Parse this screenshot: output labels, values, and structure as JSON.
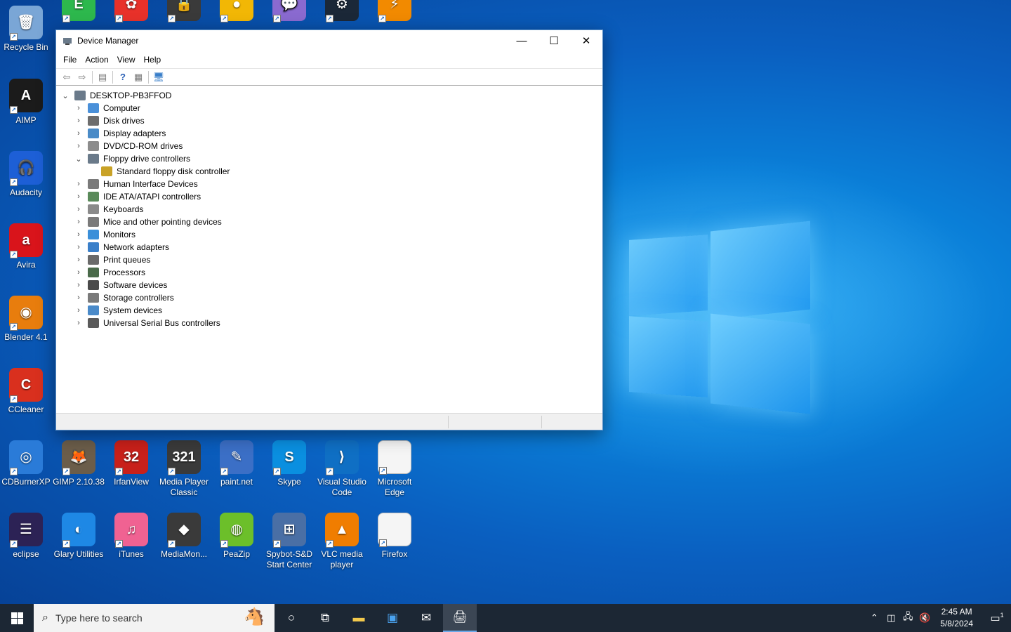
{
  "desktop": {
    "icons_col1": [
      {
        "label": "Recycle Bin",
        "color": "#7aa6d6",
        "glyph": "🗑"
      },
      {
        "label": "AIMP",
        "color": "#1b1b1b",
        "glyph": "A"
      },
      {
        "label": "Audacity",
        "color": "#1d5fd6",
        "glyph": "🎧"
      },
      {
        "label": "Avira",
        "color": "#d9141b",
        "glyph": "a"
      },
      {
        "label": "Blender 4.1",
        "color": "#e87d0d",
        "glyph": "◉"
      },
      {
        "label": "CCleaner",
        "color": "#d9301e",
        "glyph": "C"
      }
    ],
    "icons_top": [
      {
        "color": "#2db84d",
        "glyph": "E"
      },
      {
        "color": "#e8312a",
        "glyph": "✿"
      },
      {
        "color": "#3a3a3a",
        "glyph": "🔒"
      },
      {
        "color": "#f2b705",
        "glyph": "●"
      },
      {
        "color": "#8a6ad0",
        "glyph": "💬"
      },
      {
        "color": "#1b2838",
        "glyph": "⚙"
      },
      {
        "color": "#f28a00",
        "glyph": "⚡"
      }
    ],
    "icons_row1": [
      {
        "label": "CDBurnerXP",
        "color": "#2a7bd8",
        "glyph": "◎"
      },
      {
        "label": "GIMP 2.10.38",
        "color": "#6b5d4a",
        "glyph": "🦊"
      },
      {
        "label": "IrfanView",
        "color": "#c8201a",
        "glyph": "32"
      },
      {
        "label": "Media Player Classic",
        "color": "#3a3a3a",
        "glyph": "321"
      },
      {
        "label": "paint.net",
        "color": "#3b6fc6",
        "glyph": "✎"
      },
      {
        "label": "Skype",
        "color": "#0a8fe0",
        "glyph": "S"
      },
      {
        "label": "Visual Studio Code",
        "color": "#0f6fc4",
        "glyph": "⟩"
      },
      {
        "label": "Microsoft Edge",
        "color": "#f5f5f5",
        "glyph": ""
      }
    ],
    "icons_row2": [
      {
        "label": "eclipse",
        "color": "#2c2255",
        "glyph": "☰"
      },
      {
        "label": "Glary Utilities",
        "color": "#1e88e5",
        "glyph": "◐"
      },
      {
        "label": "iTunes",
        "color": "#f06292",
        "glyph": "♫"
      },
      {
        "label": "MediaMon...",
        "color": "#3a3a3a",
        "glyph": "◆"
      },
      {
        "label": "PeaZip",
        "color": "#6cbf2a",
        "glyph": "◍"
      },
      {
        "label": "Spybot-S&D Start Center",
        "color": "#4a6fa5",
        "glyph": "⊞"
      },
      {
        "label": "VLC media player",
        "color": "#f07d00",
        "glyph": "▲"
      },
      {
        "label": "Firefox",
        "color": "#f5f5f5",
        "glyph": ""
      }
    ]
  },
  "window": {
    "title": "Device Manager",
    "minimize": "—",
    "maximize": "☐",
    "close": "✕",
    "menu": [
      "File",
      "Action",
      "View",
      "Help"
    ],
    "toolbar": [
      "back",
      "forward",
      "properties",
      "help",
      "update-driver",
      "scan-hardware"
    ],
    "tree": {
      "root": "DESKTOP-PB3FFOD",
      "items": [
        {
          "label": "Computer",
          "expanded": false,
          "color": "#4a90d9"
        },
        {
          "label": "Disk drives",
          "expanded": false,
          "color": "#6d6d6d"
        },
        {
          "label": "Display adapters",
          "expanded": false,
          "color": "#4a8bc7"
        },
        {
          "label": "DVD/CD-ROM drives",
          "expanded": false,
          "color": "#8c8c8c"
        },
        {
          "label": "Floppy drive controllers",
          "expanded": true,
          "color": "#6a7a8a"
        },
        {
          "label": "Human Interface Devices",
          "expanded": false,
          "color": "#7a7a7a"
        },
        {
          "label": "IDE ATA/ATAPI controllers",
          "expanded": false,
          "color": "#5a8a5a"
        },
        {
          "label": "Keyboards",
          "expanded": false,
          "color": "#8a8a8a"
        },
        {
          "label": "Mice and other pointing devices",
          "expanded": false,
          "color": "#7a7a7a"
        },
        {
          "label": "Monitors",
          "expanded": false,
          "color": "#3a8fd9"
        },
        {
          "label": "Network adapters",
          "expanded": false,
          "color": "#3a7fc9"
        },
        {
          "label": "Print queues",
          "expanded": false,
          "color": "#6a6a6a"
        },
        {
          "label": "Processors",
          "expanded": false,
          "color": "#4a6a4a"
        },
        {
          "label": "Software devices",
          "expanded": false,
          "color": "#4a4a4a"
        },
        {
          "label": "Storage controllers",
          "expanded": false,
          "color": "#7a7a7a"
        },
        {
          "label": "System devices",
          "expanded": false,
          "color": "#4a8ac9"
        },
        {
          "label": "Universal Serial Bus controllers",
          "expanded": false,
          "color": "#5a5a5a"
        }
      ],
      "child_of_floppy": "Standard floppy disk controller"
    }
  },
  "taskbar": {
    "search_placeholder": "Type here to search",
    "time": "2:45 AM",
    "date": "5/8/2024",
    "notification_count": "1"
  }
}
